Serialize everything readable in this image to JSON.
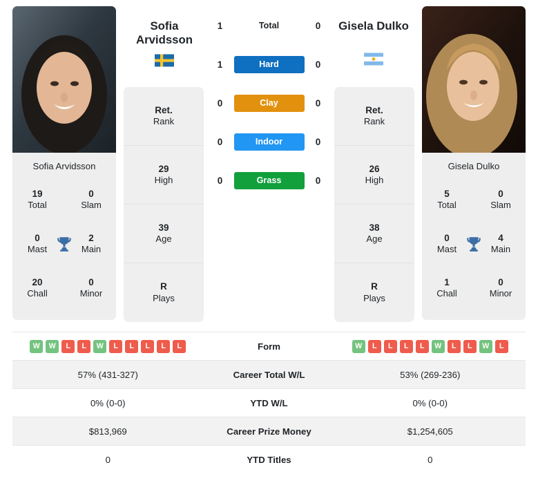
{
  "players": {
    "left": {
      "name_line1": "Sofia",
      "name_line2": "Arvidsson",
      "full_name": "Sofia Arvidsson",
      "flag_country": "Sweden",
      "meta": [
        {
          "value": "Ret.",
          "label": "Rank"
        },
        {
          "value": "29",
          "label": "High"
        },
        {
          "value": "39",
          "label": "Age"
        },
        {
          "value": "R",
          "label": "Plays"
        }
      ],
      "achievements": [
        {
          "value": "19",
          "label": "Total"
        },
        {
          "value": "0",
          "label": "Slam"
        },
        {
          "value": "0",
          "label": "Mast"
        },
        {
          "value": "2",
          "label": "Main"
        },
        {
          "value": "20",
          "label": "Chall"
        },
        {
          "value": "0",
          "label": "Minor"
        }
      ],
      "form": [
        "W",
        "W",
        "L",
        "L",
        "W",
        "L",
        "L",
        "L",
        "L",
        "L"
      ]
    },
    "right": {
      "name_line1": "Gisela Dulko",
      "name_line2": "",
      "full_name": "Gisela Dulko",
      "flag_country": "Argentina",
      "meta": [
        {
          "value": "Ret.",
          "label": "Rank"
        },
        {
          "value": "26",
          "label": "High"
        },
        {
          "value": "38",
          "label": "Age"
        },
        {
          "value": "R",
          "label": "Plays"
        }
      ],
      "achievements": [
        {
          "value": "5",
          "label": "Total"
        },
        {
          "value": "0",
          "label": "Slam"
        },
        {
          "value": "0",
          "label": "Mast"
        },
        {
          "value": "4",
          "label": "Main"
        },
        {
          "value": "1",
          "label": "Chall"
        },
        {
          "value": "0",
          "label": "Minor"
        }
      ],
      "form": [
        "W",
        "L",
        "L",
        "L",
        "L",
        "W",
        "L",
        "L",
        "W",
        "L"
      ]
    }
  },
  "h2h": {
    "rows": [
      {
        "left": "1",
        "label": "Total",
        "right": "0",
        "badge": false,
        "color": ""
      },
      {
        "left": "1",
        "label": "Hard",
        "right": "0",
        "badge": true,
        "color": "#0f6fc0"
      },
      {
        "left": "0",
        "label": "Clay",
        "right": "0",
        "badge": true,
        "color": "#e2910f"
      },
      {
        "left": "0",
        "label": "Indoor",
        "right": "0",
        "badge": true,
        "color": "#2196f3"
      },
      {
        "left": "0",
        "label": "Grass",
        "right": "0",
        "badge": true,
        "color": "#11a03c"
      }
    ]
  },
  "stats_table": {
    "rows": [
      {
        "label": "Form",
        "left": "",
        "right": "",
        "type": "form"
      },
      {
        "label": "Career Total W/L",
        "left": "57% (431-327)",
        "right": "53% (269-236)",
        "type": "text"
      },
      {
        "label": "YTD W/L",
        "left": "0% (0-0)",
        "right": "0% (0-0)",
        "type": "text"
      },
      {
        "label": "Career Prize Money",
        "left": "$813,969",
        "right": "$1,254,605",
        "type": "text"
      },
      {
        "label": "YTD Titles",
        "left": "0",
        "right": "0",
        "type": "text"
      }
    ]
  },
  "colors": {
    "hard": "#0f6fc0",
    "clay": "#e2910f",
    "indoor": "#2196f3",
    "grass": "#11a03c",
    "win": "#74c37f",
    "loss": "#ef5b4c",
    "trophy": "#3b6ea5"
  }
}
